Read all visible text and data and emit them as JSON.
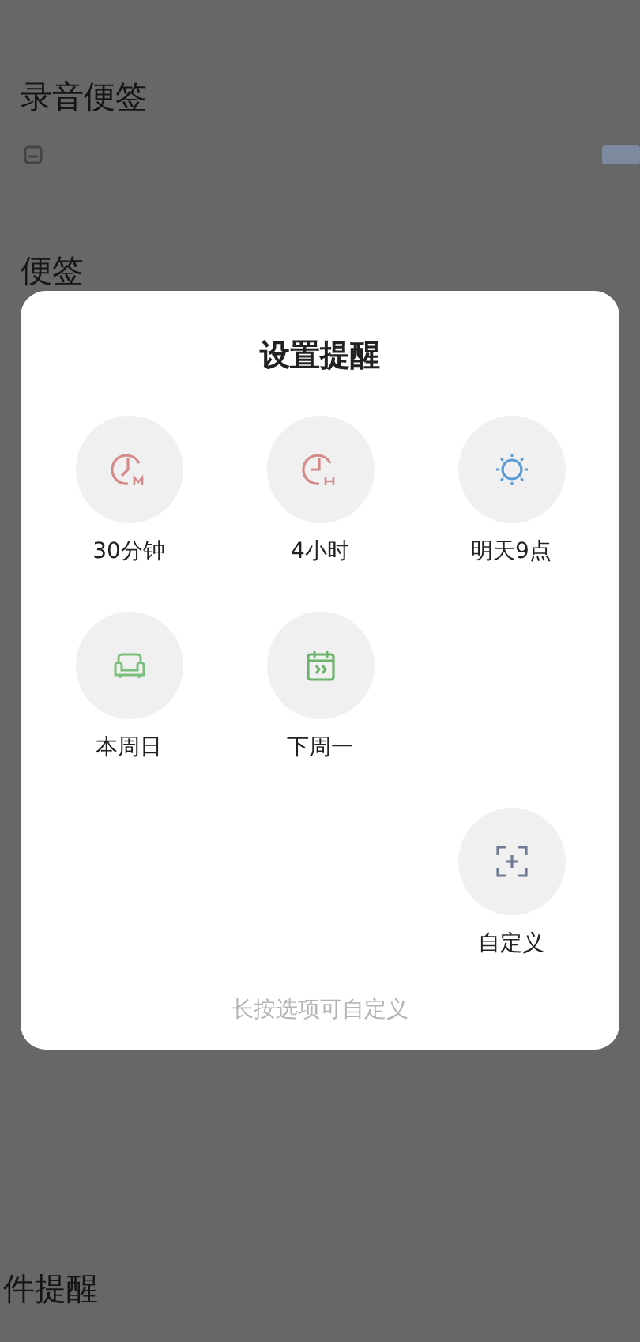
{
  "background": {
    "sections": [
      {
        "title": "录音便签"
      },
      {
        "title": "便签"
      }
    ],
    "footer_title": "件提醒"
  },
  "dialog": {
    "title": "设置提醒",
    "options": [
      {
        "kind": "clock-m",
        "label": "30分钟"
      },
      {
        "kind": "clock-h",
        "label": "4小时"
      },
      {
        "kind": "sun",
        "label": "明天9点"
      },
      {
        "kind": "sofa",
        "label": "本周日"
      },
      {
        "kind": "calendar",
        "label": "下周一"
      },
      {
        "kind": "custom",
        "label": "自定义"
      }
    ],
    "hint": "长按选项可自定义"
  }
}
